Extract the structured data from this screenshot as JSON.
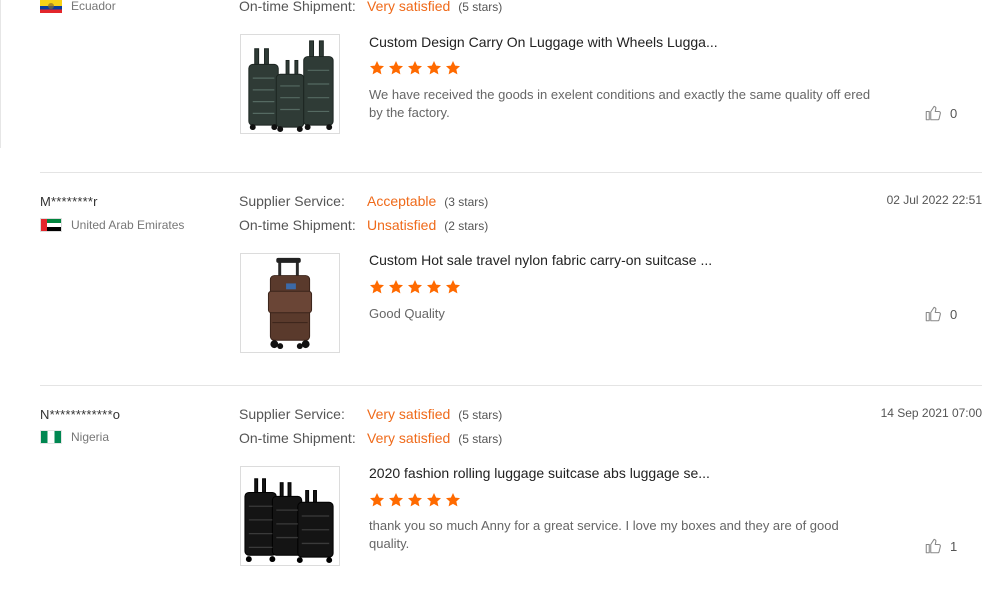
{
  "labels": {
    "supplier_service": "Supplier Service:",
    "on_time_shipment": "On-time Shipment:"
  },
  "reviews": [
    {
      "reviewer": "",
      "country": "Ecuador",
      "flag_icon": "ecuador-flag-icon",
      "date": "",
      "on_time_shipment": {
        "value": "Very satisfied",
        "stars": "(5 stars)"
      },
      "product_title": "Custom Design Carry On Luggage with Wheels Lugga...",
      "rating": 5,
      "review_text": "We have received the goods in exelent conditions and exactly the same quality off ered by the factory.",
      "helpful_count": "0"
    },
    {
      "reviewer": "M********r",
      "country": "United Arab Emirates",
      "flag_icon": "uae-flag-icon",
      "date": "02 Jul 2022 22:51",
      "supplier_service": {
        "value": "Acceptable",
        "stars": "(3 stars)"
      },
      "on_time_shipment": {
        "value": "Unsatisfied",
        "stars": "(2 stars)"
      },
      "product_title": "Custom Hot sale travel nylon fabric carry-on suitcase ...",
      "rating": 5,
      "review_text": "Good Quality",
      "helpful_count": "0"
    },
    {
      "reviewer": "N************o",
      "country": "Nigeria",
      "flag_icon": "nigeria-flag-icon",
      "date": "14 Sep 2021 07:00",
      "supplier_service": {
        "value": "Very satisfied",
        "stars": "(5 stars)"
      },
      "on_time_shipment": {
        "value": "Very satisfied",
        "stars": "(5 stars)"
      },
      "product_title": "2020 fashion rolling luggage suitcase abs luggage se...",
      "rating": 5,
      "review_text": "thank you so much Anny for a great service. I love my boxes and they are of good quality.",
      "helpful_count": "1"
    }
  ],
  "colors": {
    "accent": "#ef6a1a",
    "star": "#ff6a00",
    "divider": "#e4e4e4"
  }
}
